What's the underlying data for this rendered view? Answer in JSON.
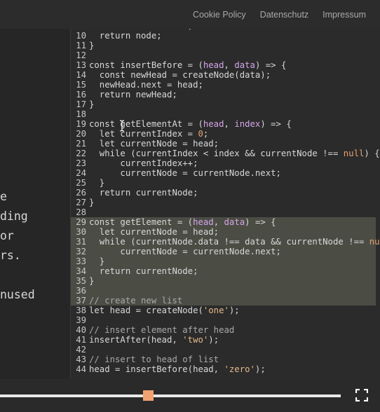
{
  "nav": {
    "links": [
      "Cookie Policy",
      "Datenschutz",
      "Impressum"
    ]
  },
  "left_panel": {
    "lines": [
      "e",
      "ding",
      "or",
      "rs.",
      "",
      "nused"
    ]
  },
  "code": {
    "lines": [
      {
        "n": "9",
        "segs": [
          [
            "  newHead = newNode;",
            "t"
          ]
        ]
      },
      {
        "n": "10",
        "segs": [
          [
            "  return node;",
            "t"
          ]
        ]
      },
      {
        "n": "11",
        "segs": [
          [
            "}",
            "t"
          ]
        ]
      },
      {
        "n": "12",
        "segs": []
      },
      {
        "n": "13",
        "segs": [
          [
            "const insertBefore = (",
            "t"
          ],
          [
            "head",
            "pm"
          ],
          [
            ", ",
            "t"
          ],
          [
            "data",
            "pm"
          ],
          [
            ") => {",
            "t"
          ]
        ]
      },
      {
        "n": "14",
        "segs": [
          [
            "  const newHead = createNode(data);",
            "t"
          ]
        ]
      },
      {
        "n": "15",
        "segs": [
          [
            "  newHead.next = head;",
            "t"
          ]
        ]
      },
      {
        "n": "16",
        "segs": [
          [
            "  return newHead;",
            "t"
          ]
        ]
      },
      {
        "n": "17",
        "segs": [
          [
            "}",
            "t"
          ]
        ]
      },
      {
        "n": "18",
        "segs": []
      },
      {
        "n": "19",
        "segs": [
          [
            "const getElementAt = (",
            "t"
          ],
          [
            "head",
            "pm"
          ],
          [
            ", ",
            "t"
          ],
          [
            "index",
            "pm"
          ],
          [
            ") => {",
            "t"
          ]
        ]
      },
      {
        "n": "20",
        "segs": [
          [
            "  let currentIndex = ",
            "t"
          ],
          [
            "0",
            "num"
          ],
          [
            ";",
            "t"
          ]
        ]
      },
      {
        "n": "21",
        "segs": [
          [
            "  let currentNode = head;",
            "t"
          ]
        ]
      },
      {
        "n": "22",
        "segs": [
          [
            "  while (currentIndex < index && currentNode !== ",
            "t"
          ],
          [
            "null",
            "num"
          ],
          [
            ") {",
            "t"
          ]
        ]
      },
      {
        "n": "23",
        "segs": [
          [
            "      currentIndex++;",
            "t"
          ]
        ]
      },
      {
        "n": "24",
        "segs": [
          [
            "      currentNode = currentNode.next;",
            "t"
          ]
        ]
      },
      {
        "n": "25",
        "segs": [
          [
            "  }",
            "t"
          ]
        ]
      },
      {
        "n": "26",
        "segs": [
          [
            "  return currentNode;",
            "t"
          ]
        ]
      },
      {
        "n": "27",
        "segs": [
          [
            "}",
            "t"
          ]
        ]
      },
      {
        "n": "28",
        "segs": []
      },
      {
        "n": "29",
        "segs": [
          [
            "const getElement = (",
            "t"
          ],
          [
            "head",
            "pm"
          ],
          [
            ", ",
            "t"
          ],
          [
            "data",
            "pm"
          ],
          [
            ") => {",
            "t"
          ]
        ]
      },
      {
        "n": "30",
        "segs": [
          [
            "  let currentNode = head;",
            "t"
          ]
        ]
      },
      {
        "n": "31",
        "segs": [
          [
            "  while (currentNode.data !== data && currentNode !== ",
            "t"
          ],
          [
            "null",
            "num"
          ]
        ]
      },
      {
        "n": "32",
        "segs": [
          [
            "      currentNode = currentNode.next;",
            "t"
          ]
        ]
      },
      {
        "n": "33",
        "segs": [
          [
            "  }",
            "t"
          ]
        ]
      },
      {
        "n": "34",
        "segs": [
          [
            "  return currentNode;",
            "t"
          ]
        ]
      },
      {
        "n": "35",
        "segs": [
          [
            "}",
            "t"
          ]
        ]
      },
      {
        "n": "36",
        "segs": []
      },
      {
        "n": "37",
        "segs": [
          [
            "// create new list",
            "cm"
          ]
        ]
      },
      {
        "n": "38",
        "segs": [
          [
            "let head = createNode(",
            "t"
          ],
          [
            "'one'",
            "str"
          ],
          [
            ");",
            "t"
          ]
        ]
      },
      {
        "n": "39",
        "segs": []
      },
      {
        "n": "40",
        "segs": [
          [
            "// insert element after head",
            "cm"
          ]
        ]
      },
      {
        "n": "41",
        "segs": [
          [
            "insertAfter(head, ",
            "t"
          ],
          [
            "'two'",
            "str"
          ],
          [
            ");",
            "t"
          ]
        ]
      },
      {
        "n": "42",
        "segs": []
      },
      {
        "n": "43",
        "segs": [
          [
            "// insert to head of list",
            "cm"
          ]
        ]
      },
      {
        "n": "44",
        "segs": [
          [
            "head = insertBefore(head, ",
            "t"
          ],
          [
            "'zero'",
            "str"
          ],
          [
            ");",
            "t"
          ]
        ]
      }
    ]
  },
  "player": {
    "progress": 0.435,
    "accent": "#f1a271",
    "fullscreen_icon": "fullscreen-icon"
  }
}
